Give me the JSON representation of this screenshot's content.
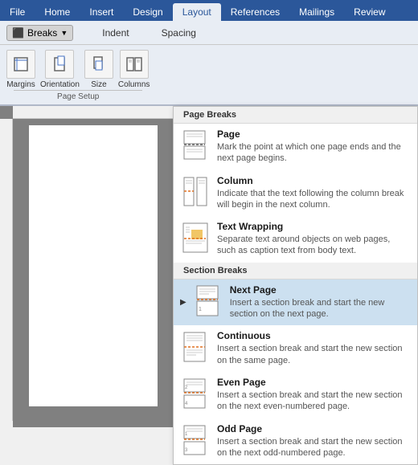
{
  "tabs": [
    {
      "label": "File",
      "active": false
    },
    {
      "label": "Home",
      "active": false
    },
    {
      "label": "Insert",
      "active": false
    },
    {
      "label": "Design",
      "active": false
    },
    {
      "label": "Layout",
      "active": true
    },
    {
      "label": "References",
      "active": false
    },
    {
      "label": "Mailings",
      "active": false
    },
    {
      "label": "Review",
      "active": false
    }
  ],
  "toolbar": {
    "breaks_label": "Breaks",
    "indent_label": "Indent",
    "spacing_label": "Spacing",
    "page_setup_label": "Page Setup"
  },
  "ribbon_icons": [
    {
      "name": "Margins",
      "label": "Margins"
    },
    {
      "name": "Orientation",
      "label": "Orientation"
    },
    {
      "name": "Size",
      "label": "Size"
    },
    {
      "name": "Columns",
      "label": "Columns"
    }
  ],
  "dropdown": {
    "page_breaks_header": "Page Breaks",
    "section_breaks_header": "Section Breaks",
    "items": [
      {
        "id": "page",
        "title": "Page",
        "description": "Mark the point at which one page ends\nand the next page begins.",
        "section": "page"
      },
      {
        "id": "column",
        "title": "Column",
        "description": "Indicate that the text following the column\nbreak will begin in the next column.",
        "section": "page"
      },
      {
        "id": "text-wrapping",
        "title": "Text Wrapping",
        "description": "Separate text around objects on web\npages, such as caption text from body text.",
        "section": "page"
      },
      {
        "id": "next-page",
        "title": "Next Page",
        "description": "Insert a section break and start the new\nsection on the next page.",
        "section": "section",
        "selected": true
      },
      {
        "id": "continuous",
        "title": "Continuous",
        "description": "Insert a section break and start the new\nsection on the same page.",
        "section": "section"
      },
      {
        "id": "even-page",
        "title": "Even Page",
        "description": "Insert a section break and start the new\nsection on the next even-numbered page.",
        "section": "section"
      },
      {
        "id": "odd-page",
        "title": "Odd Page",
        "description": "Insert a section break and start the new\nsection on the next odd-numbered page.",
        "section": "section"
      }
    ]
  }
}
